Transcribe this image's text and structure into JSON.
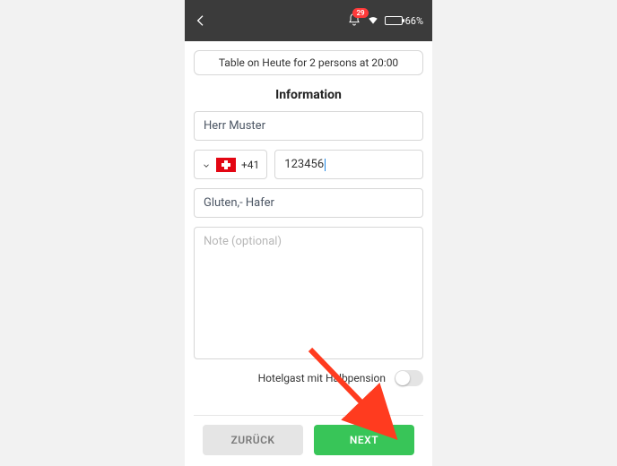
{
  "statusbar": {
    "notification_count": "29",
    "battery_text": "66%",
    "battery_fill_pct": 66
  },
  "summary": {
    "text": "Table on Heute for 2 persons at 20:00"
  },
  "section_title": "Information",
  "form": {
    "name": "Herr Muster",
    "country_code": "+41",
    "phone": "123456",
    "allergy": "Gluten,- Hafer",
    "note_placeholder": "Note (optional)"
  },
  "toggle": {
    "label": "Hotelgast mit Halbpension"
  },
  "footer": {
    "back": "ZURÜCK",
    "next": "NEXT"
  }
}
